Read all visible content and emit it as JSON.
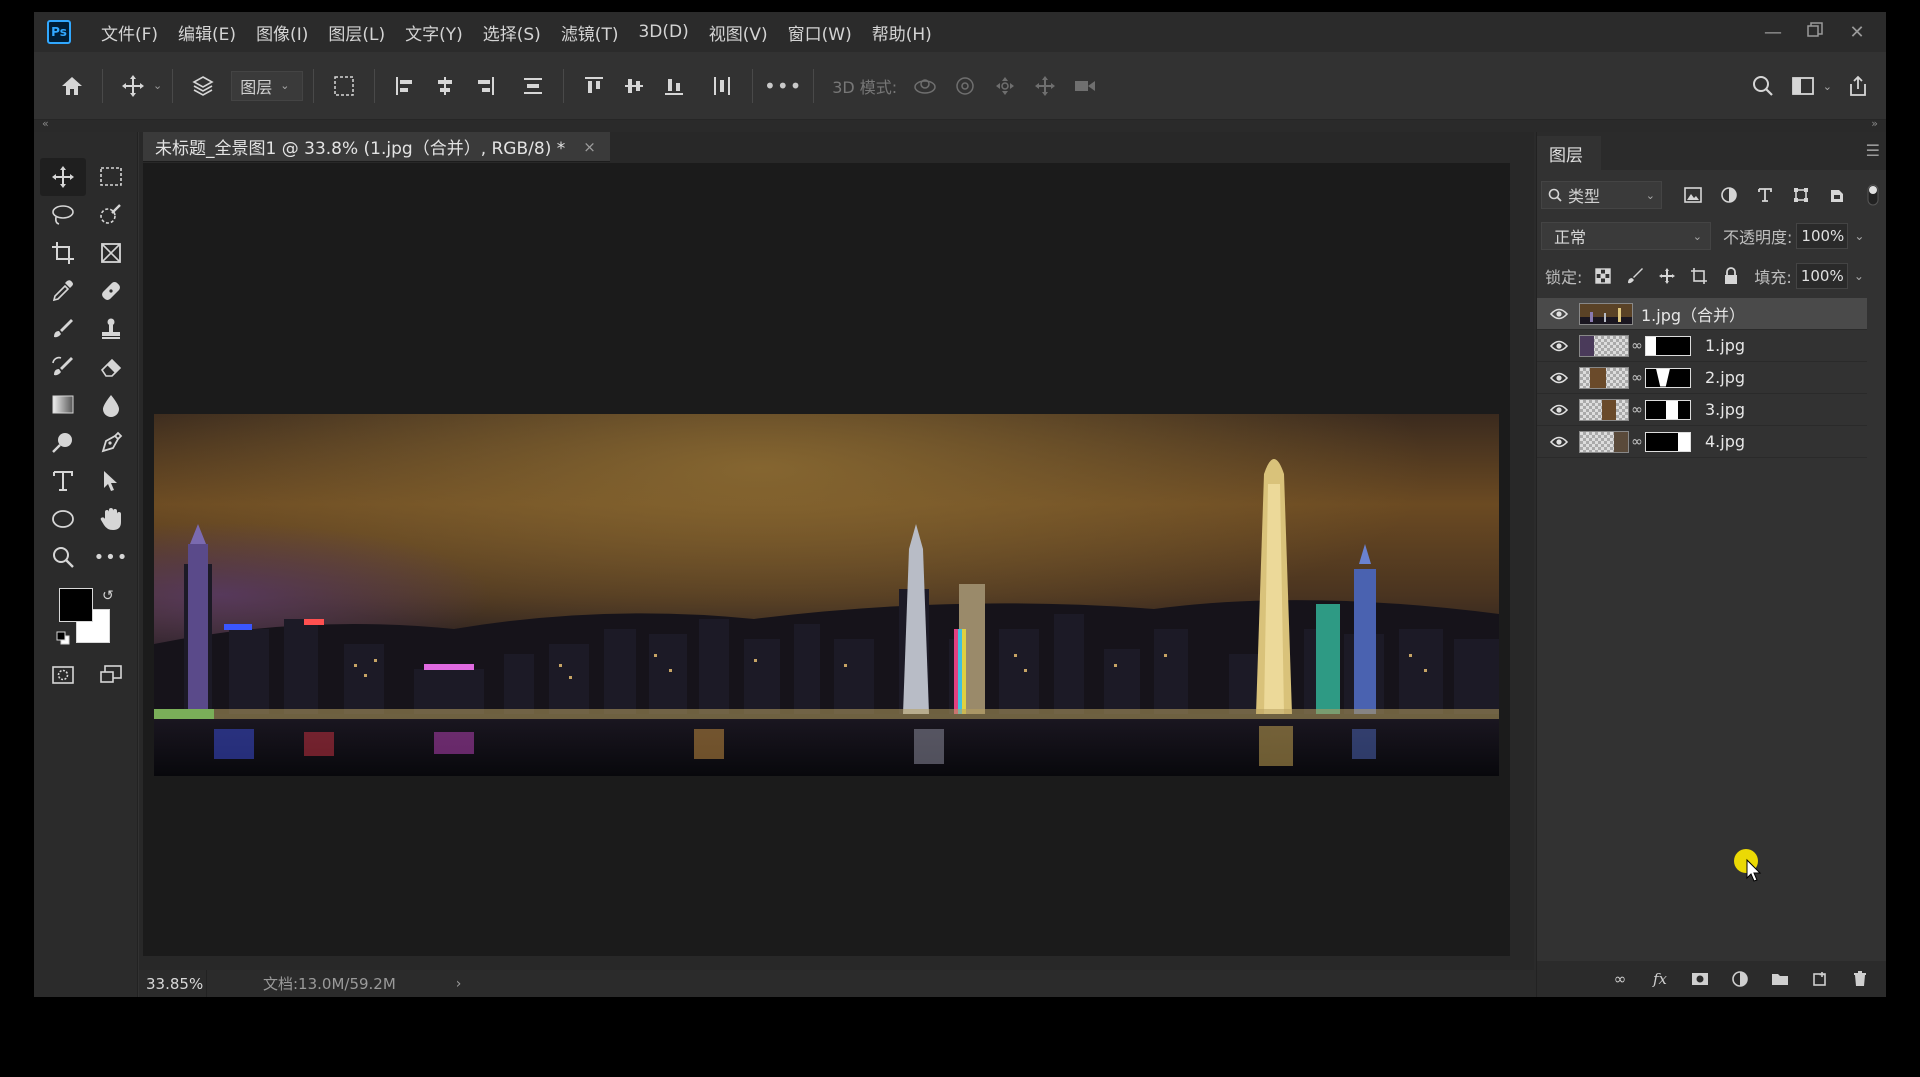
{
  "menu": {
    "items": [
      "文件(F)",
      "编辑(E)",
      "图像(I)",
      "图层(L)",
      "文字(Y)",
      "选择(S)",
      "滤镜(T)",
      "3D(D)",
      "视图(V)",
      "窗口(W)",
      "帮助(H)"
    ]
  },
  "app_logo": "Ps",
  "options_bar": {
    "auto_select_target": "图层",
    "mode_3d_label": "3D 模式:"
  },
  "document": {
    "tab_title": "未标题_全景图1 @ 33.8% (1.jpg（合并）, RGB/8) *",
    "tab_close": "×",
    "zoom": "33.85%",
    "doc_info": "文档:13.0M/59.2M",
    "status_arrow": "›"
  },
  "layers_panel": {
    "tab_label": "图层",
    "filter_kind": "类型",
    "blend_mode": "正常",
    "opacity_label": "不透明度:",
    "opacity_value": "100%",
    "lock_label": "锁定:",
    "fill_label": "填充:",
    "fill_value": "100%",
    "layers": [
      {
        "name": "1.jpg（合并）",
        "selected": true,
        "has_mask": false
      },
      {
        "name": "1.jpg",
        "selected": false,
        "has_mask": true
      },
      {
        "name": "2.jpg",
        "selected": false,
        "has_mask": true
      },
      {
        "name": "3.jpg",
        "selected": false,
        "has_mask": true
      },
      {
        "name": "4.jpg",
        "selected": false,
        "has_mask": true
      }
    ]
  },
  "colors": {
    "accent": "#31a8ff",
    "foreground": "#000000",
    "background": "#ffffff",
    "cursor_highlight": "#ffeb00"
  }
}
